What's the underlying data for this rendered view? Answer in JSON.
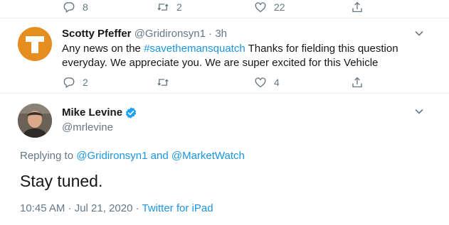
{
  "colors": {
    "accent": "#1b95e0",
    "secondary": "#657786",
    "text": "#14171a",
    "divider": "#e6ecf0",
    "ut_orange": "#e58d1e"
  },
  "top_tweet": {
    "replies": "8",
    "retweets": "2",
    "likes": "22",
    "icons": [
      "reply-icon",
      "retweet-icon",
      "like-icon",
      "share-icon"
    ]
  },
  "reply_tweet": {
    "name": "Scotty Pfeffer",
    "handle": "@Gridironsyn1",
    "separator": "·",
    "time": "3h",
    "text_before": "Any news on the ",
    "hashtag": "#savethemansquatch",
    "text_after": " Thanks for fielding this question everyday. We appreciate you. We are super excited for this Vehicle",
    "replies": "2",
    "retweets": "",
    "likes": "4"
  },
  "main_tweet": {
    "name": "Mike Levine",
    "verified": true,
    "handle": "@mrlevine",
    "replying_label": "Replying to ",
    "reply_user_1": "@Gridironsyn1",
    "reply_and": " and ",
    "reply_user_2": "@MarketWatch",
    "text": "Stay tuned.",
    "timestamp": "10:45 AM · Jul 21, 2020",
    "meta_sep": " · ",
    "source": "Twitter for iPad"
  }
}
